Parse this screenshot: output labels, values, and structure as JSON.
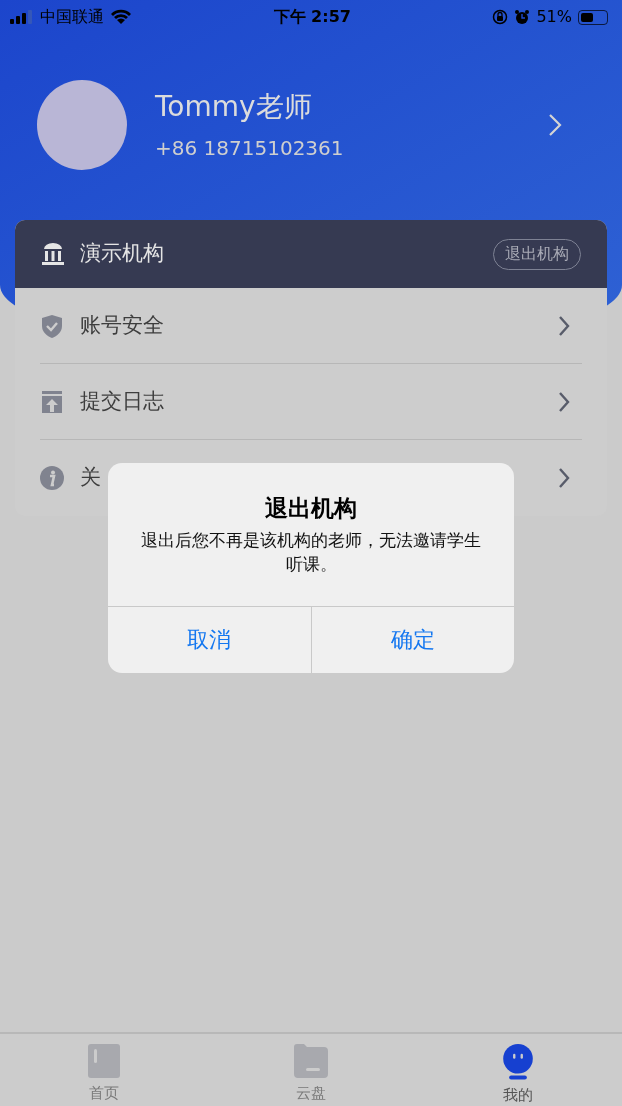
{
  "status_bar": {
    "carrier": "中国联通",
    "time": "下午 2:57",
    "battery": "51%",
    "battery_meter": {
      "level": 0.51
    }
  },
  "profile": {
    "name": "Tommy老师",
    "phone": "+86 18715102361"
  },
  "organization": {
    "name": "演示机构",
    "action": "退出机构"
  },
  "menu": [
    {
      "kind": "security",
      "label": "账号安全"
    },
    {
      "kind": "log",
      "label": "提交日志"
    },
    {
      "kind": "about",
      "label": "关"
    }
  ],
  "dialog": {
    "title": "退出机构",
    "message": "退出后您不再是该机构的老师，无法邀请学生听课。",
    "buttons": [
      "取消",
      "确定"
    ]
  },
  "tabs": [
    {
      "kind": "home",
      "label": "首页",
      "selected": false
    },
    {
      "kind": "cloud",
      "label": "云盘",
      "selected": false
    },
    {
      "kind": "me",
      "label": "我的",
      "selected": true
    }
  ]
}
